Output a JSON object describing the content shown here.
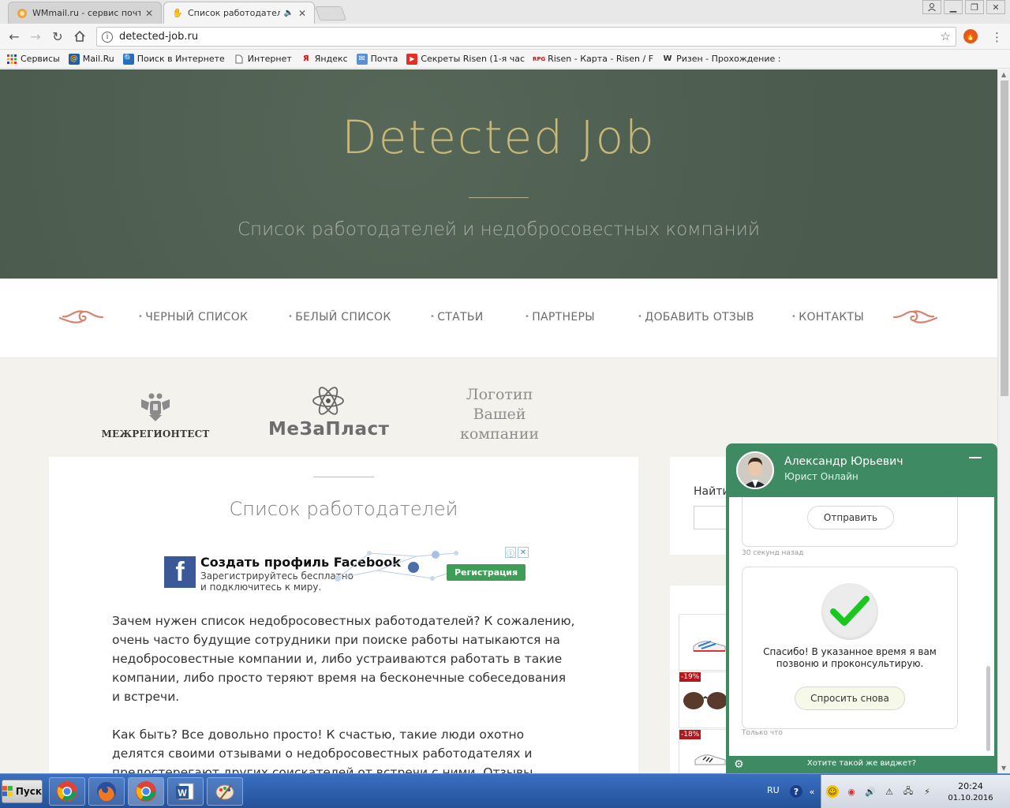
{
  "browser": {
    "tabs": [
      {
        "title": "WMmail.ru - сервис почтовых рассылок",
        "active": false
      },
      {
        "title": "Список работодателей и недобросовестных компаний",
        "active": true
      }
    ],
    "url": "detected-job.ru",
    "bookmarks": [
      {
        "label": "Сервисы",
        "icon": "apps-grid-icon"
      },
      {
        "label": "Mail.Ru",
        "icon": "mailru-icon"
      },
      {
        "label": "Поиск в Интернете",
        "icon": "search-icon"
      },
      {
        "label": "Интернет",
        "icon": "page-icon"
      },
      {
        "label": "Яндекс",
        "icon": "yandex-icon"
      },
      {
        "label": "Почта",
        "icon": "mail-icon"
      },
      {
        "label": "Секреты Risen (1-я час",
        "icon": "youtube-icon"
      },
      {
        "label": "Risen - Карта - Risen / F",
        "icon": "rpg-icon"
      },
      {
        "label": "Ризен - Прохождение :",
        "icon": "w-icon"
      }
    ]
  },
  "site": {
    "title": "Detected Job",
    "tagline": "Список работодателей и недобросовестных компаний",
    "nav": [
      "ЧЕРНЫЙ СПИСОК",
      "БЕЛЫЙ СПИСОК",
      "СТАТЬИ",
      "ПАРТНЕРЫ",
      "ДОБАВИТЬ ОТЗЫВ",
      "КОНТАКТЫ"
    ],
    "logos": {
      "mrt": "МЕЖРЕГИОНТЕСТ",
      "mzp": "МеЗаПласт",
      "your_line1": "Логотип",
      "your_line2": "Вашей",
      "your_line3": "компании"
    },
    "page_title": "Список работодателей",
    "ad": {
      "headline": "Создать профиль Facebook",
      "sub1": "Зарегистрируйтесь бесплатно",
      "sub2": "и подключитесь к миру.",
      "cta": "Регистрация"
    },
    "paragraphs": [
      "Зачем нужен список недобросовестных работодателей? К сожалению, очень часто будущие сотрудники при поиске работы натыкаются на недобросовестные компании и, либо устраиваются работать в такие компании, либо просто теряют время на бесконечные собеседования и встречи.",
      "Как быть? Все довольно просто! К счастью, такие люди охотно делятся своими отзывами о недобросовестных работодателях и предостерегают других соискателей от встречи с ними. Отзывы попадают в список"
    ],
    "search_label": "Найти",
    "discounts": [
      "-19%",
      "-18%"
    ]
  },
  "chat": {
    "agent_name": "Александр Юрьевич",
    "agent_role": "Юрист Онлайн",
    "send_button": "Отправить",
    "time_ago": "30 секунд назад",
    "thanks_line1": "Спасибо! В указанное время я вам",
    "thanks_line2": "позвоню и проконсультирую.",
    "ask_again": "Спросить снова",
    "just_now": "Только что",
    "footer": "Хотите такой же виджет?"
  },
  "taskbar": {
    "start": "Пуск",
    "lang": "RU",
    "time": "20:24",
    "date": "01.10.2016"
  },
  "colors": {
    "hero_bg": "#4f5f52",
    "title_gold": "#c7b878",
    "chat_green": "#3e8b63",
    "ad_green": "#3e9e58",
    "fb_blue": "#3b5998"
  }
}
